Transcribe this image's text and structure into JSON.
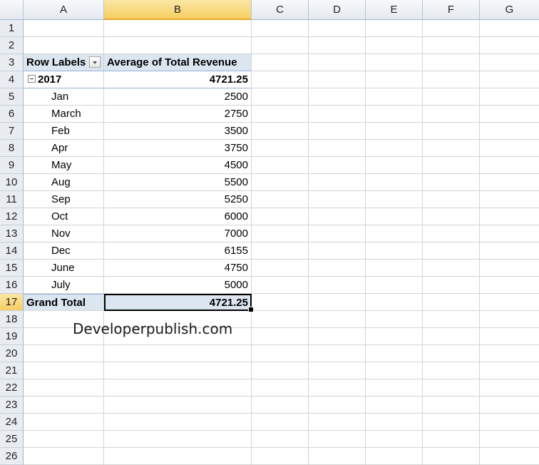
{
  "columns": [
    "A",
    "B",
    "C",
    "D",
    "E",
    "F",
    "G"
  ],
  "rows": [
    "1",
    "2",
    "3",
    "4",
    "5",
    "6",
    "7",
    "8",
    "9",
    "10",
    "11",
    "12",
    "13",
    "14",
    "15",
    "16",
    "17",
    "18",
    "19",
    "20",
    "21",
    "22",
    "23",
    "24",
    "25",
    "26"
  ],
  "pivot": {
    "row_labels_header": "Row Labels",
    "value_header": "Average of Total Revenue",
    "year": "2017",
    "year_value": "4721.25",
    "months": [
      {
        "label": "Jan",
        "value": "2500"
      },
      {
        "label": "March",
        "value": "2750"
      },
      {
        "label": "Feb",
        "value": "3500"
      },
      {
        "label": "Apr",
        "value": "3750"
      },
      {
        "label": "May",
        "value": "4500"
      },
      {
        "label": "Aug",
        "value": "5500"
      },
      {
        "label": "Sep",
        "value": "5250"
      },
      {
        "label": "Oct",
        "value": "6000"
      },
      {
        "label": "Nov",
        "value": "7000"
      },
      {
        "label": "Dec",
        "value": "6155"
      },
      {
        "label": "June",
        "value": "4750"
      },
      {
        "label": "July",
        "value": "5000"
      }
    ],
    "grand_total_label": "Grand Total",
    "grand_total_value": "4721.25"
  },
  "watermark": "Developerpublish.com",
  "icons": {
    "filter_dropdown": "dropdown-arrow-icon",
    "collapse": "collapse-minus-icon"
  },
  "colors": {
    "pivot_fill": "#dce6f1",
    "selected_header": "#f6cf62"
  }
}
